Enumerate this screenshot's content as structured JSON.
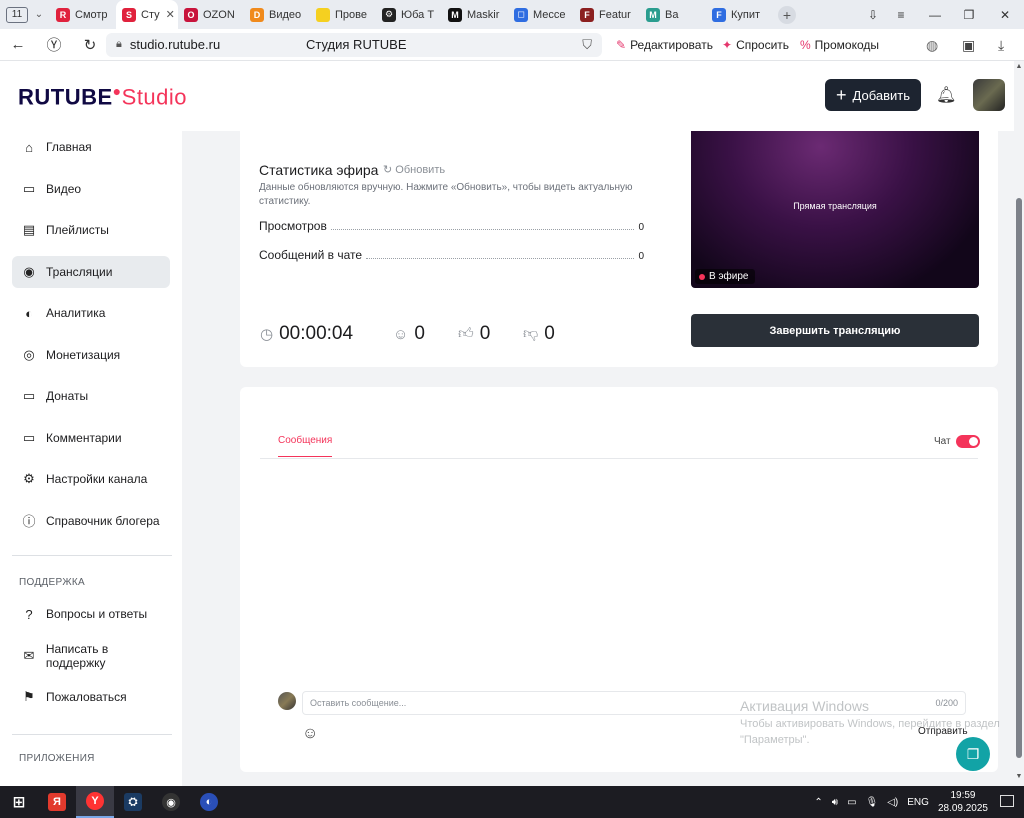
{
  "browser": {
    "tab_count": "11",
    "tabs": [
      {
        "label": "Смотр",
        "fav_color": "#e0223d",
        "fav_text": "R"
      },
      {
        "label": "Сту",
        "fav_color": "#e0223d",
        "fav_text": "S",
        "active": true
      },
      {
        "label": "OZON",
        "fav_color": "#c8143c",
        "fav_text": "O"
      },
      {
        "label": "Видео",
        "fav_color": "#f08a1c",
        "fav_text": "D"
      },
      {
        "label": "Прове",
        "fav_color": "#f5d020",
        "fav_text": ""
      },
      {
        "label": "Юба Т",
        "fav_color": "#222222",
        "fav_text": "⚙"
      },
      {
        "label": "Maskir",
        "fav_color": "#111111",
        "fav_text": "M"
      },
      {
        "label": "Мессе",
        "fav_color": "#2f6de1",
        "fav_text": "◻"
      },
      {
        "label": "Featur",
        "fav_color": "#8b1f1f",
        "fav_text": "F"
      },
      {
        "label": "Ва",
        "fav_color": "#2a9d8f",
        "fav_text": "M"
      },
      {
        "label": "Купит",
        "fav_color": "#2f6de1",
        "fav_text": "F"
      }
    ],
    "url": "studio.rutube.ru",
    "page_title": "Студия RUTUBE",
    "ext_edit": "Редактировать",
    "ext_ask": "Спросить",
    "ext_promo": "Промокоды"
  },
  "header": {
    "logo_main": "RUTUBE",
    "logo_studio": "Studio",
    "add_label": "Добавить"
  },
  "sidebar": {
    "items": [
      {
        "label": "Главная",
        "icon": "home-icon",
        "glyph": "⌂"
      },
      {
        "label": "Видео",
        "icon": "video-icon",
        "glyph": "▭"
      },
      {
        "label": "Плейлисты",
        "icon": "playlist-icon",
        "glyph": "▤"
      },
      {
        "label": "Трансляции",
        "icon": "broadcast-icon",
        "glyph": "◉",
        "active": true
      },
      {
        "label": "Аналитика",
        "icon": "analytics-icon",
        "glyph": "◐"
      },
      {
        "label": "Монетизация",
        "icon": "monetization-icon",
        "glyph": "◎"
      },
      {
        "label": "Донаты",
        "icon": "donate-icon",
        "glyph": "▭"
      },
      {
        "label": "Комментарии",
        "icon": "comments-icon",
        "glyph": "▭"
      },
      {
        "label": "Настройки канала",
        "icon": "settings-icon",
        "glyph": "⚙"
      },
      {
        "label": "Справочник блогера",
        "icon": "info-icon",
        "glyph": "ⓘ"
      }
    ],
    "support_heading": "ПОДДЕРЖКА",
    "support_items": [
      {
        "label": "Вопросы и ответы",
        "icon": "faq-icon",
        "glyph": "?"
      },
      {
        "label": "Написать в поддержку",
        "icon": "mail-icon",
        "glyph": "✉"
      },
      {
        "label": "Пожаловаться",
        "icon": "flag-icon",
        "glyph": "⚑"
      }
    ],
    "apps_heading": "ПРИЛОЖЕНИЯ"
  },
  "stats": {
    "title": "Статистика эфира",
    "refresh": "Обновить",
    "note": "Данные обновляются вручную. Нажмите «Обновить», чтобы видеть актуальную статистику.",
    "views_label": "Просмотров",
    "views_value": "0",
    "chat_label": "Сообщений в чате",
    "chat_value": "0",
    "duration": "00:00:04",
    "viewers": "0",
    "likes": "0",
    "dislikes": "0"
  },
  "preview": {
    "label": "Прямая трансляция",
    "onair": "В эфире",
    "end_button": "Завершить трансляцию"
  },
  "chat": {
    "tab": "Сообщения",
    "toggle_label": "Чат",
    "placeholder": "Оставить сообщение...",
    "counter": "0/200",
    "send": "Отправить"
  },
  "watermark": {
    "title": "Активация Windows",
    "text": "Чтобы активировать Windows, перейдите в раздел \"Параметры\"."
  },
  "taskbar": {
    "lang": "ENG",
    "time": "19:59",
    "date": "28.09.2025"
  }
}
